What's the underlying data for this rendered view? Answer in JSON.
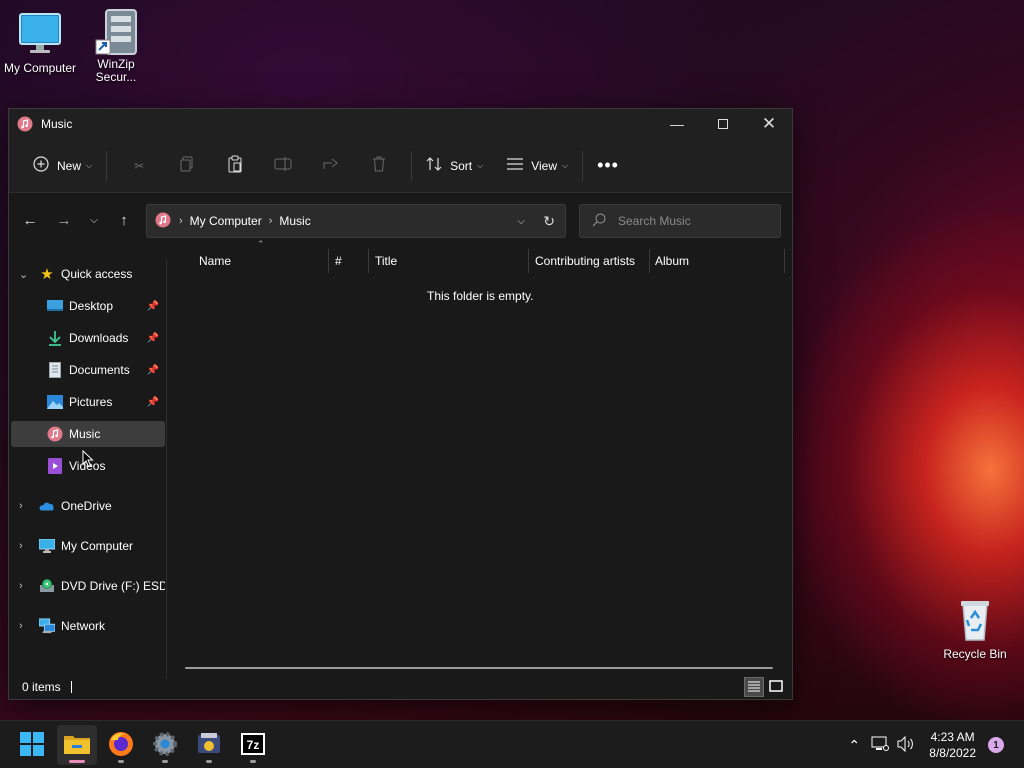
{
  "desktop": {
    "icons": [
      {
        "label": "My Computer"
      },
      {
        "label": "WinZip Secur..."
      },
      {
        "label": "Recycle Bin"
      }
    ]
  },
  "window": {
    "title": "Music",
    "toolbar": {
      "new_label": "New",
      "sort_label": "Sort",
      "view_label": "View"
    },
    "address": {
      "crumbs": [
        "My Computer",
        "Music"
      ]
    },
    "search": {
      "placeholder": "Search Music"
    },
    "nav": {
      "quick_access": "Quick access",
      "items": [
        {
          "label": "Desktop",
          "pinned": true
        },
        {
          "label": "Downloads",
          "pinned": true
        },
        {
          "label": "Documents",
          "pinned": true
        },
        {
          "label": "Pictures",
          "pinned": true
        },
        {
          "label": "Music",
          "pinned": false,
          "selected": true
        },
        {
          "label": "Videos",
          "pinned": false
        }
      ],
      "roots": [
        {
          "label": "OneDrive"
        },
        {
          "label": "My Computer"
        },
        {
          "label": "DVD Drive (F:) ESD-I"
        },
        {
          "label": "Network"
        }
      ]
    },
    "columns": [
      "Name",
      "#",
      "Title",
      "Contributing artists",
      "Album"
    ],
    "empty_message": "This folder is empty.",
    "status": {
      "item_count": "0 items"
    }
  },
  "taskbar": {
    "clock": {
      "time": "4:23 AM",
      "date": "8/8/2022"
    },
    "notification_count": "1"
  },
  "colors": {
    "accent_pink": "#e98ab8",
    "folder_yellow": "#f2c12e",
    "star": "#f5c518"
  }
}
